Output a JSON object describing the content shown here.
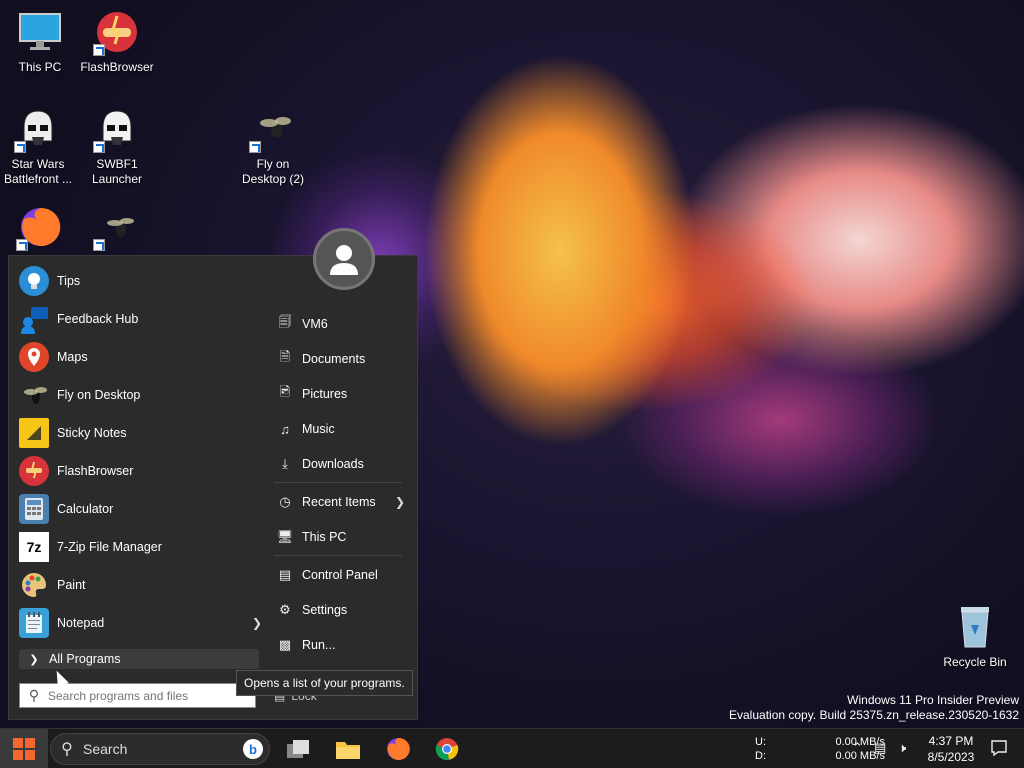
{
  "desktop": {
    "icons": [
      {
        "label": "This PC",
        "icon": "monitor-icon"
      },
      {
        "label": "FlashBrowser",
        "icon": "flash-browser-icon"
      },
      {
        "label": "Star Wars Battlefront ...",
        "icon": "stormtrooper-icon"
      },
      {
        "label": "SWBF1 Launcher",
        "icon": "stormtrooper-icon"
      },
      {
        "label": "Fly on Desktop (2)",
        "icon": "fly-icon"
      },
      {
        "label": "Recycle Bin",
        "icon": "recycle-bin-icon"
      }
    ]
  },
  "start_menu": {
    "programs": [
      {
        "label": "Tips",
        "icon": "lightbulb-icon",
        "color": "#2b8fd8"
      },
      {
        "label": "Feedback Hub",
        "icon": "feedback-icon",
        "color": "#1a6fd8"
      },
      {
        "label": "Maps",
        "icon": "map-pin-icon",
        "color": "#e0452a"
      },
      {
        "label": "Fly on Desktop",
        "icon": "fly-icon",
        "color": "#333333"
      },
      {
        "label": "Sticky Notes",
        "icon": "sticky-note-icon",
        "color": "#f5c518"
      },
      {
        "label": "FlashBrowser",
        "icon": "flash-browser-icon",
        "color": "#d8323a"
      },
      {
        "label": "Calculator",
        "icon": "calculator-icon",
        "color": "#4a7fb0"
      },
      {
        "label": "7-Zip File Manager",
        "icon": "seven-zip-icon",
        "color": "#ffffff"
      },
      {
        "label": "Paint",
        "icon": "palette-icon",
        "color": "#3aa0d8"
      },
      {
        "label": "Notepad",
        "icon": "notepad-icon",
        "color": "#3aa0d8"
      }
    ],
    "all_programs_label": "All Programs",
    "search_placeholder": "Search programs and files",
    "places": [
      {
        "label": "VM6",
        "icon": "user-folder-icon"
      },
      {
        "label": "Documents",
        "icon": "document-icon"
      },
      {
        "label": "Pictures",
        "icon": "picture-icon"
      },
      {
        "label": "Music",
        "icon": "music-note-icon"
      },
      {
        "label": "Downloads",
        "icon": "download-icon"
      },
      {
        "label": "Recent Items",
        "icon": "clock-icon"
      },
      {
        "label": "This PC",
        "icon": "computer-icon"
      },
      {
        "label": "Control Panel",
        "icon": "control-panel-icon"
      },
      {
        "label": "Settings",
        "icon": "gear-icon"
      },
      {
        "label": "Run...",
        "icon": "run-icon"
      }
    ],
    "lock_label": "Lock",
    "tooltip": "Opens a list of your programs."
  },
  "watermark": {
    "line1": "Windows 11 Pro Insider Preview",
    "line2": "Evaluation copy. Build 25375.zn_release.230520-1632"
  },
  "taskbar": {
    "search_label": "Search",
    "net_upload_label": "U:",
    "net_download_label": "D:",
    "net_upload_value": "0.00 MB/s",
    "net_download_value": "0.00 MB/s",
    "time": "4:37 PM",
    "date": "8/5/2023"
  }
}
